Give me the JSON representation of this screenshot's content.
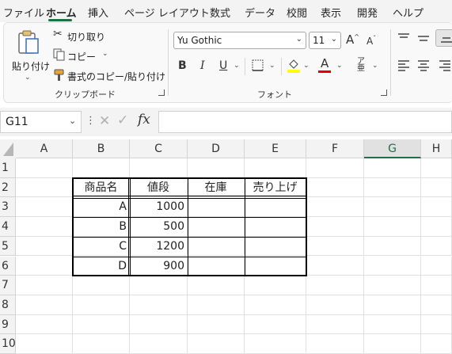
{
  "menu": {
    "tabs": [
      "ファイル",
      "ホーム",
      "挿入",
      "ページ レイアウト",
      "数式",
      "データ",
      "校閲",
      "表示",
      "開発",
      "ヘルプ"
    ],
    "active_tab": "ホーム"
  },
  "clipboard": {
    "paste_label": "貼り付け",
    "cut_label": "切り取り",
    "copy_label": "コピー",
    "format_painter_label": "書式のコピー/貼り付け",
    "group_label": "クリップボード"
  },
  "font": {
    "name_value": "Yu Gothic",
    "size_value": "11",
    "bold": "B",
    "italic": "I",
    "underline": "U",
    "font_color_letter": "A",
    "group_label": "フォント"
  },
  "formula_bar": {
    "name_box": "G11",
    "formula": ""
  },
  "grid": {
    "columns": [
      "A",
      "B",
      "C",
      "D",
      "E",
      "F",
      "G",
      "H"
    ],
    "selected_column": "G",
    "rows": [
      "1",
      "2",
      "3",
      "4",
      "5",
      "6",
      "7",
      "8",
      "9",
      "10"
    ],
    "table": {
      "headers": [
        "商品名",
        "値段",
        "在庫",
        "売り上げ"
      ],
      "rows": [
        [
          "A",
          "1000",
          "",
          ""
        ],
        [
          "B",
          "500",
          "",
          ""
        ],
        [
          "C",
          "1200",
          "",
          ""
        ],
        [
          "D",
          "900",
          "",
          ""
        ]
      ]
    }
  }
}
